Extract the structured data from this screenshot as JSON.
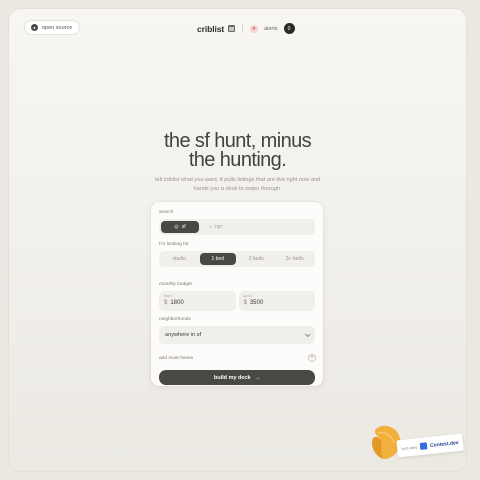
{
  "header": {
    "open_source_label": "open source",
    "brand": "criblist",
    "alerts_label": "alerts",
    "alerts_count": "0"
  },
  "hero": {
    "title_line1": "the sf hunt, minus",
    "title_line2": "the hunting.",
    "subtitle": "tell criblist what you want. it pulls listings that are live right now and hands you a deck to swipe through."
  },
  "form": {
    "area_label": "search",
    "area_options": [
      {
        "label": "sf",
        "icon": "pin-icon",
        "active": true
      },
      {
        "label": "nyc",
        "icon": "city-icon",
        "active": false
      }
    ],
    "looking_label": "I'm looking for",
    "bed_options": [
      {
        "label": "studio",
        "active": false
      },
      {
        "label": "1 bed",
        "active": true
      },
      {
        "label": "2 beds",
        "active": false
      },
      {
        "label": "3+ beds",
        "active": false
      }
    ],
    "budget_label": "monthly budget",
    "budget_from_label": "from",
    "budget_to_label": "up to",
    "currency": "$",
    "budget_from": "1800",
    "budget_to": "3500",
    "neighborhoods_label": "neighborhoods",
    "neighborhoods_value": "anywhere in sf",
    "must_haves_label": "add must-haves",
    "build_label": "build my deck"
  },
  "contest": {
    "prefix": "built using",
    "name": "Contest.dev"
  },
  "colors": {
    "accent": "#4a4845",
    "background": "#f4f2ee",
    "contest_blue": "#2f6fde"
  }
}
